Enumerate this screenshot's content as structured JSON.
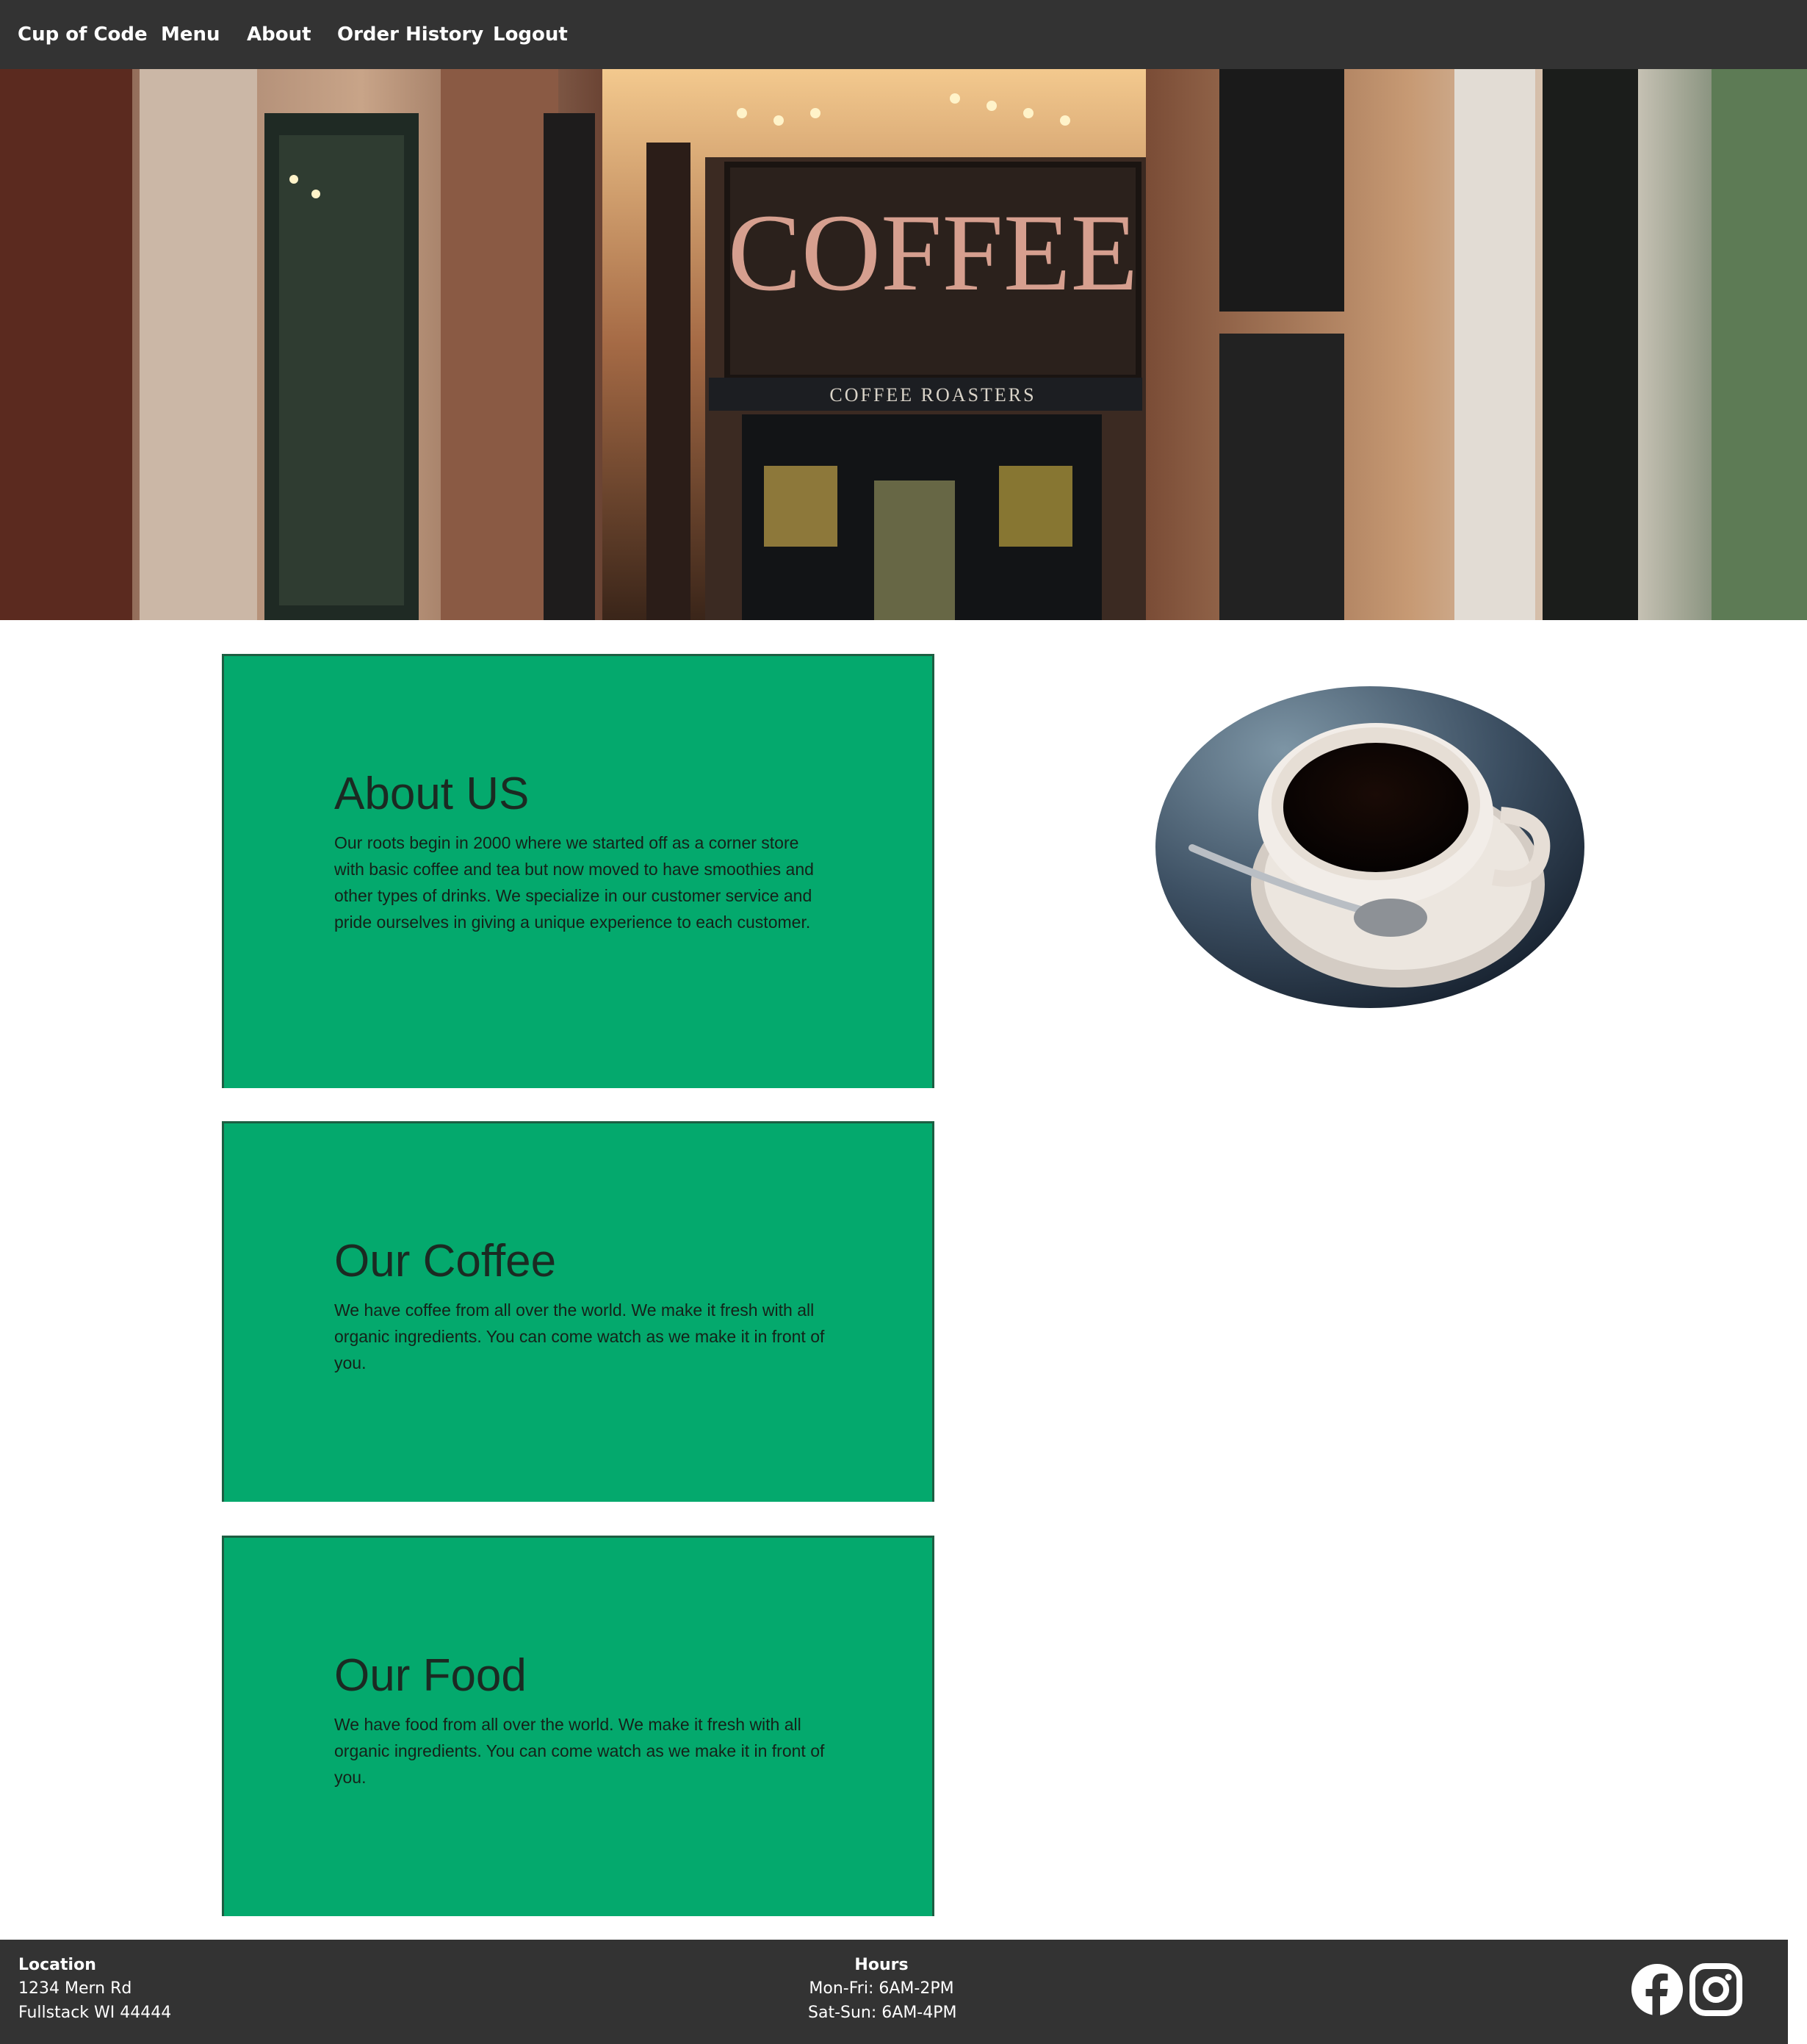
{
  "nav": {
    "brand": "Cup of Code",
    "links": [
      "Menu",
      "About",
      "Order History",
      "Logout"
    ]
  },
  "hero": {
    "image": "coffee-shop-storefront",
    "sign_text": "COFFEE ROASTERS"
  },
  "cards": [
    {
      "title": "About US",
      "text": "Our roots begin in 2000 where we started off as a corner store with basic coffee and tea but now moved to have smoothies and other types of drinks. We specialize in our customer service and pride ourselves in giving a unique experience to each customer."
    },
    {
      "title": "Our Coffee",
      "text": "We have coffee from all over the world. We make it fresh with all organic ingredients. You can come watch as we make it in front of you."
    },
    {
      "title": "Our Food",
      "text": "We have food from all over the world. We make it fresh with all organic ingredients. You can come watch as we make it in front of you."
    }
  ],
  "side_image": "coffee-cup-photo",
  "footer": {
    "location_heading": "Location",
    "address_line1": "1234 Mern Rd",
    "address_line2": "Fullstack WI 44444",
    "hours_heading": "Hours",
    "hours_weekday": "Mon-Fri: 6AM-2PM",
    "hours_weekend": "Sat-Sun: 6AM-4PM",
    "social_icons": [
      "facebook-icon",
      "instagram-icon"
    ]
  },
  "colors": {
    "nav_bg": "#333333",
    "card_bg": "#04a96d",
    "card_border": "#1d5e42",
    "footer_bg": "#333333"
  }
}
